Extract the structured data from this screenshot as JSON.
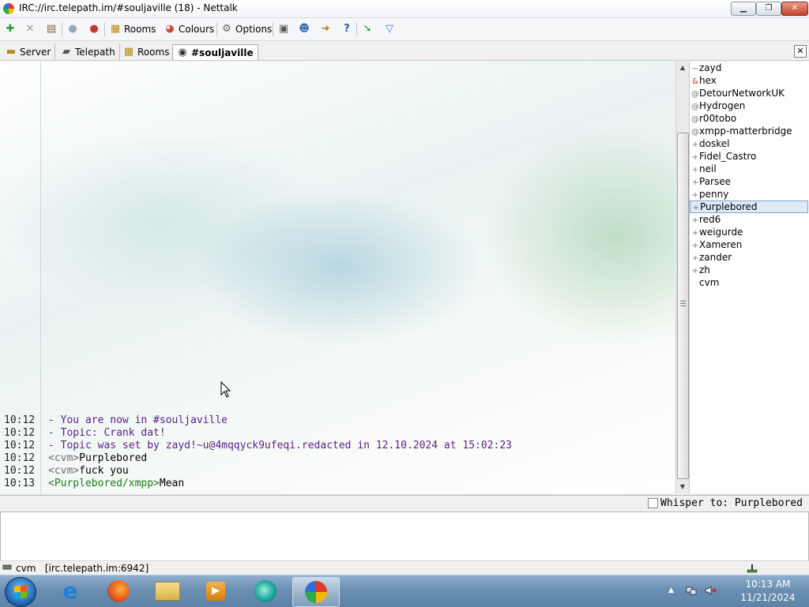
{
  "window": {
    "title": "IRC://irc.telepath.im/#souljaville (18)  -  Nettalk",
    "minimize": "▁",
    "maximize": "❐",
    "close": "✕"
  },
  "toolbar": {
    "rooms_label": "Rooms",
    "colours_label": "Colours",
    "options_label": "Options"
  },
  "tabs": [
    {
      "label": "Server"
    },
    {
      "label": "Telepath"
    },
    {
      "label": "Rooms"
    },
    {
      "label": "#souljaville"
    }
  ],
  "tab_close": "✕",
  "messages": [
    {
      "time": "10:12",
      "text": "- You are now in #souljaville"
    },
    {
      "time": "10:12",
      "text": "- Topic: Crank dat!"
    },
    {
      "time": "10:12",
      "text": "- Topic was set by zayd!~u@4mqqyck9ufeqi.redacted in 12.10.2024 at 15:02:23"
    },
    {
      "time": "10:12",
      "nick": "<cvm>",
      "text": "Purplebored"
    },
    {
      "time": "10:12",
      "nick": "<cvm>",
      "text": "fuck you"
    },
    {
      "time": "10:13",
      "nick": "<Purplebored/xmpp>",
      "text": "Mean"
    }
  ],
  "users": [
    {
      "prefix": "~",
      "name": "zayd"
    },
    {
      "prefix": "&",
      "name": "hex"
    },
    {
      "prefix": "@",
      "name": "DetourNetworkUK"
    },
    {
      "prefix": "@",
      "name": "Hydrogen"
    },
    {
      "prefix": "@",
      "name": "r00tobo"
    },
    {
      "prefix": "@",
      "name": "xmpp-matterbridge"
    },
    {
      "prefix": "+",
      "name": "doskel"
    },
    {
      "prefix": "+",
      "name": "Fidel_Castro"
    },
    {
      "prefix": "+",
      "name": "neil"
    },
    {
      "prefix": "+",
      "name": "Parsee"
    },
    {
      "prefix": "+",
      "name": "penny"
    },
    {
      "prefix": "+",
      "name": "Purplebored",
      "selected": true
    },
    {
      "prefix": "+",
      "name": "red6"
    },
    {
      "prefix": "+",
      "name": "weigurde"
    },
    {
      "prefix": "+",
      "name": "Xameren"
    },
    {
      "prefix": "+",
      "name": "zander"
    },
    {
      "prefix": "+",
      "name": "zh"
    },
    {
      "prefix": "",
      "name": "cvm"
    }
  ],
  "whisper": {
    "label": "Whisper to: Purplebored",
    "checked": false
  },
  "input": {
    "value": ""
  },
  "status": {
    "user": "cvm",
    "server": "[irc.telepath.im:6942]"
  },
  "taskbar": {
    "apps": [
      {
        "icon": "internet-explorer-icon"
      },
      {
        "icon": "firefox-icon"
      },
      {
        "icon": "file-explorer-icon"
      },
      {
        "icon": "media-player-icon"
      },
      {
        "icon": "green-circle-app-icon"
      },
      {
        "icon": "nettalk-icon",
        "active": true
      }
    ],
    "clock_time": "10:13 AM",
    "clock_date": "11/21/2024"
  },
  "colors": {
    "system_message": "#5a1f8c",
    "nick_cvm": "#6b6b6b",
    "nick_xmpp": "#1e7a1e",
    "selection": "#dfeaf7",
    "close_button": "#c9412a"
  }
}
